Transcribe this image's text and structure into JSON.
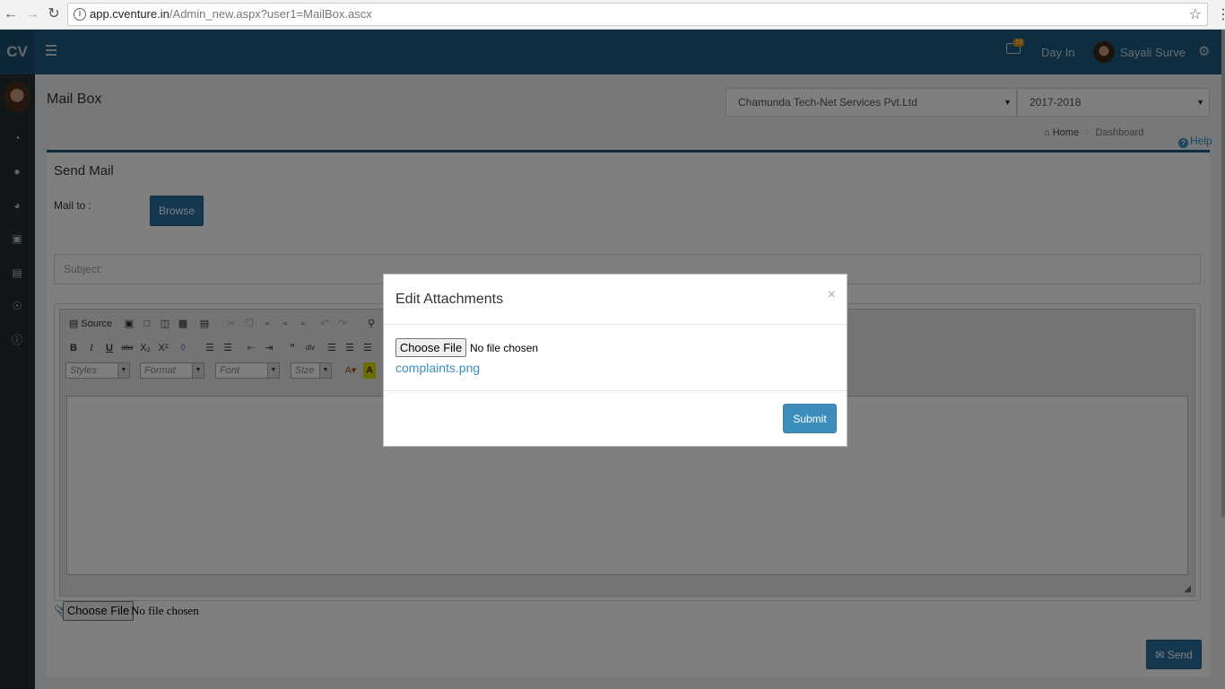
{
  "browser": {
    "url_host": "app.cventure.in",
    "url_path": "/Admin_new.aspx?user1=MailBox.ascx"
  },
  "header": {
    "logo": "CV",
    "notification_count": "13",
    "day_in": "Day In",
    "user_name": "Sayali Surve"
  },
  "page": {
    "title": "Mail Box",
    "company_select": "Chamunda Tech-Net Services Pvt.Ltd",
    "year_select": "2017-2018",
    "breadcrumb_home": "Home",
    "breadcrumb_current": "Dashboard",
    "help": "Help"
  },
  "send_mail": {
    "title": "Send Mail",
    "mail_to_label": "Mail to :",
    "browse_label": "Browse",
    "subject_placeholder": "Subject:",
    "choose_file": "Choose File",
    "no_file": "No file chosen",
    "send_label": "Send"
  },
  "editor": {
    "source_label": "Source",
    "combos": [
      "Styles",
      "Format",
      "Font",
      "Size"
    ]
  },
  "modal": {
    "title": "Edit Attachments",
    "close": "×",
    "choose_file": "Choose File",
    "no_file": "No file chosen",
    "attachment": "complaints.png",
    "submit_label": "Submit"
  },
  "icons": {
    "back": "back-arrow-icon",
    "forward": "forward-arrow-icon",
    "reload": "reload-icon",
    "info": "info-icon",
    "star": "star-icon",
    "menu": "hamburger-menu-icon",
    "camera": "camera-icon",
    "gear": "gears-icon",
    "sidebar": [
      "dashboard-icon",
      "user-icon",
      "pie-chart-icon",
      "cart-icon",
      "credit-card-icon",
      "globe-icon",
      "info-circle-icon"
    ]
  },
  "colors": {
    "header": "#1e5a80",
    "sidebar": "#222d32",
    "primary_button": "#3c8dbc",
    "link": "#3c8dbc"
  }
}
